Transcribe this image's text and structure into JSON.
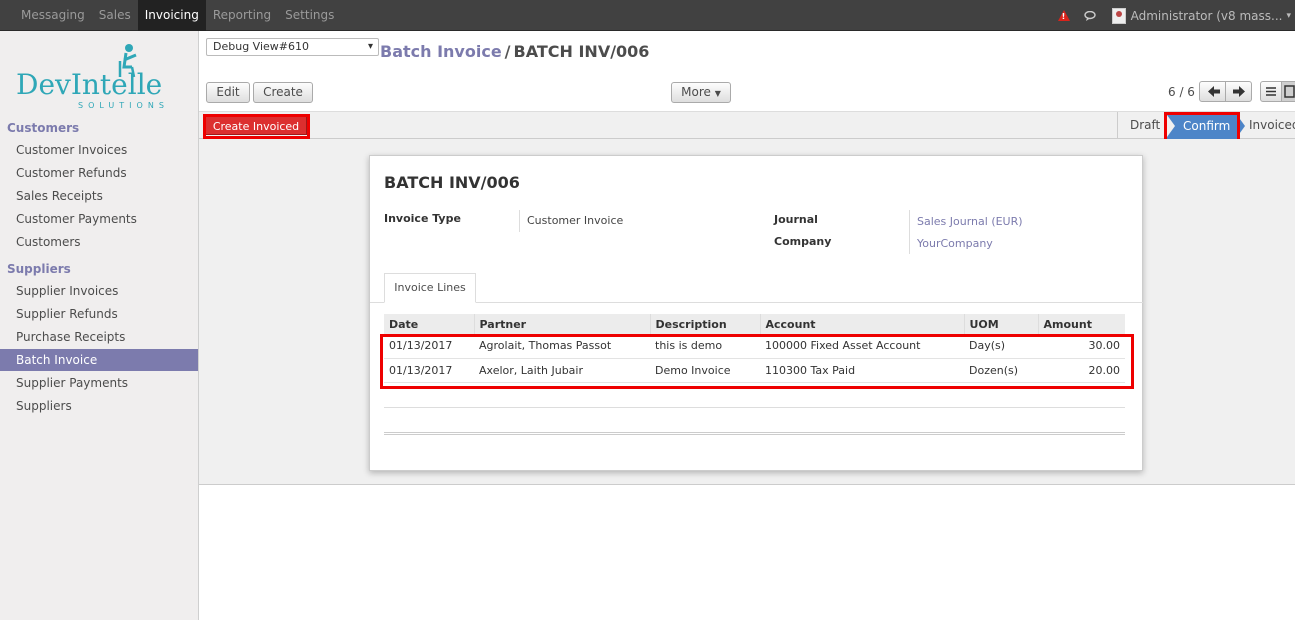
{
  "topmenu": {
    "items": [
      {
        "label": "Messaging",
        "active": false
      },
      {
        "label": "Sales",
        "active": false
      },
      {
        "label": "Invoicing",
        "active": true
      },
      {
        "label": "Reporting",
        "active": false
      },
      {
        "label": "Settings",
        "active": false
      }
    ],
    "user": "Administrator (v8  mass..."
  },
  "logo": {
    "top": "DevIntelle",
    "bottom": "SOLUTIONS"
  },
  "sidebar": {
    "sections": [
      {
        "title": "Customers",
        "items": [
          "Customer Invoices",
          "Customer Refunds",
          "Sales Receipts",
          "Customer Payments",
          "Customers"
        ]
      },
      {
        "title": "Suppliers",
        "items": [
          "Supplier Invoices",
          "Supplier Refunds",
          "Purchase Receipts",
          "Batch Invoice",
          "Supplier Payments",
          "Suppliers"
        ]
      }
    ],
    "active_item": "Batch Invoice"
  },
  "control_panel": {
    "debug_select": "Debug View#610",
    "breadcrumb_parent": "Batch Invoice",
    "breadcrumb_sep": "/",
    "breadcrumb_current": "BATCH INV/006",
    "edit_label": "Edit",
    "create_label": "Create",
    "more_label": "More",
    "pager": "6 / 6"
  },
  "statusbar": {
    "action_label": "Create Invoiced",
    "steps": [
      "Draft",
      "Confirm",
      "Invoiced"
    ],
    "current_step": "Confirm"
  },
  "form": {
    "title": "BATCH INV/006",
    "invoice_type_label": "Invoice Type",
    "invoice_type_value": "Customer Invoice",
    "journal_label": "Journal",
    "journal_value": "Sales Journal (EUR)",
    "company_label": "Company",
    "company_value": "YourCompany",
    "tab_label": "Invoice Lines",
    "columns": [
      "Date",
      "Partner",
      "Description",
      "Account",
      "UOM",
      "Amount"
    ],
    "rows": [
      [
        "01/13/2017",
        "Agrolait, Thomas Passot",
        "this is demo",
        "100000 Fixed Asset Account",
        "Day(s)",
        "30.00"
      ],
      [
        "01/13/2017",
        "Axelor, Laith Jubair",
        "Demo Invoice",
        "110300 Tax Paid",
        "Dozen(s)",
        "20.00"
      ]
    ]
  },
  "colors": {
    "accent": "#7c7bad",
    "highlight": "#e00000",
    "confirm": "#4d85c8",
    "action": "#dc2f2f"
  }
}
